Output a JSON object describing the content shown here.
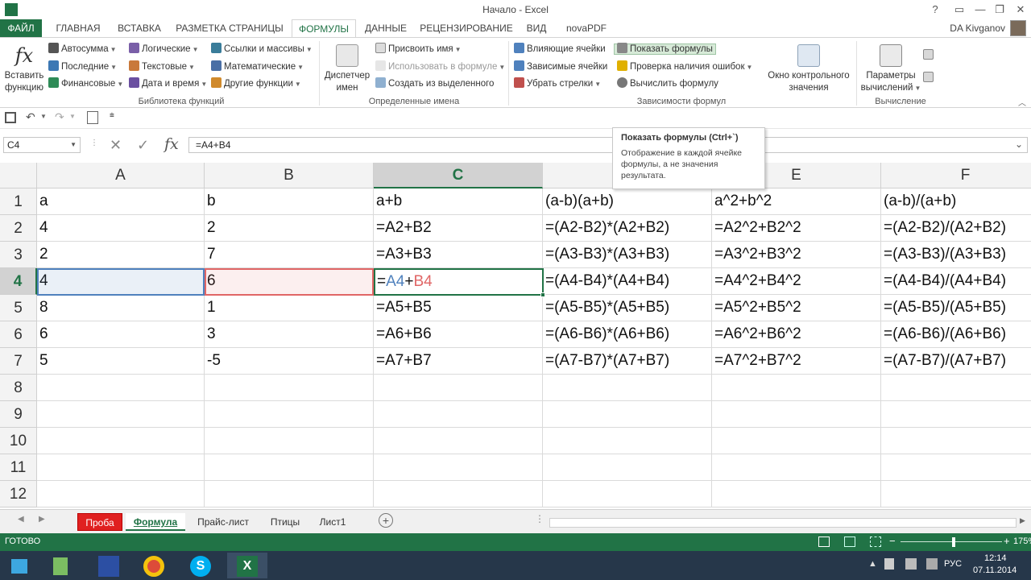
{
  "window": {
    "title": "Начало - Excel",
    "help": "?",
    "minimize": "—",
    "maximize": "❐",
    "close": "✕"
  },
  "tabs": [
    "ФАЙЛ",
    "ГЛАВНАЯ",
    "ВСТАВКА",
    "РАЗМЕТКА СТРАНИЦЫ",
    "ФОРМУЛЫ",
    "ДАННЫЕ",
    "РЕЦЕНЗИРОВАНИЕ",
    "ВИД",
    "novaPDF"
  ],
  "active_tab": "ФОРМУЛЫ",
  "user": "DA Kivganov",
  "ribbon": {
    "insert_fn": {
      "line1": "Вставить",
      "line2": "функцию",
      "icon_glyph": "fx"
    },
    "lib": {
      "autosum": "Автосумма",
      "recent": "Последние",
      "financial": "Финансовые",
      "logical": "Логические",
      "text": "Текстовые",
      "datetime": "Дата и время",
      "lookup": "Ссылки и массивы",
      "math": "Математические",
      "other": "Другие функции",
      "label": "Библиотека функций"
    },
    "names": {
      "manager_l1": "Диспетчер",
      "manager_l2": "имен",
      "assign": "Присвоить имя",
      "use_in_formula": "Использовать в формуле",
      "create_from_sel": "Создать из выделенного",
      "label": "Определенные имена"
    },
    "audit": {
      "precedents": "Влияющие ячейки",
      "dependents": "Зависимые ячейки",
      "remove_arrows": "Убрать стрелки",
      "show_formulas": "Показать формулы",
      "error_check": "Проверка наличия ошибок",
      "evaluate": "Вычислить формулу",
      "watch_l1": "Окно контрольного",
      "watch_l2": "значения",
      "label": "Зависимости формул"
    },
    "calc": {
      "options_l1": "Параметры",
      "options_l2": "вычислений",
      "label": "Вычисление"
    }
  },
  "formula_bar": {
    "name_box": "C4",
    "fx": "fx",
    "cancel": "✕",
    "enter": "✓",
    "content": "=A4+B4"
  },
  "tooltip": {
    "title": "Показать формулы (Ctrl+`)",
    "body": "Отображение в каждой ячейке формулы, а не значения результата."
  },
  "columns": [
    "A",
    "B",
    "C",
    "D",
    "E",
    "F"
  ],
  "row_numbers": [
    "1",
    "2",
    "3",
    "4",
    "5",
    "6",
    "7",
    "8",
    "9",
    "10",
    "11",
    "12"
  ],
  "rows": [
    [
      "a",
      "b",
      "a+b",
      "(a-b)(a+b)",
      "a^2+b^2",
      "(a-b)/(a+b)"
    ],
    [
      "4",
      "2",
      "=A2+B2",
      "=(A2-B2)*(A2+B2)",
      "=A2^2+B2^2",
      "=(A2-B2)/(A2+B2)"
    ],
    [
      "2",
      "7",
      "=A3+B3",
      "=(A3-B3)*(A3+B3)",
      "=A3^2+B3^2",
      "=(A3-B3)/(A3+B3)"
    ],
    [
      "4",
      "6",
      "=A4+B4",
      "=(A4-B4)*(A4+B4)",
      "=A4^2+B4^2",
      "=(A4-B4)/(A4+B4)"
    ],
    [
      "8",
      "1",
      "=A5+B5",
      "=(A5-B5)*(A5+B5)",
      "=A5^2+B5^2",
      "=(A5-B5)/(A5+B5)"
    ],
    [
      "6",
      "3",
      "=A6+B6",
      "=(A6-B6)*(A6+B6)",
      "=A6^2+B6^2",
      "=(A6-B6)/(A6+B6)"
    ],
    [
      "5",
      "-5",
      "=A7+B7",
      "=(A7-B7)*(A7+B7)",
      "=A7^2+B7^2",
      "=(A7-B7)/(A7+B7)"
    ],
    [
      "",
      "",
      "",
      "",
      "",
      ""
    ],
    [
      "",
      "",
      "",
      "",
      "",
      ""
    ],
    [
      "",
      "",
      "",
      "",
      "",
      ""
    ],
    [
      "",
      "",
      "",
      "",
      "",
      ""
    ],
    [
      "",
      "",
      "",
      "",
      "",
      ""
    ]
  ],
  "active_cell": {
    "eq": "=",
    "ref_a": "A4",
    "plus": "+",
    "ref_b": "B4"
  },
  "sheets": [
    "Проба",
    "Формула",
    "Прайс-лист",
    "Птицы",
    "Лист1"
  ],
  "active_sheet": "Формула",
  "status": {
    "ready": "ГОТОВО",
    "zoom": "175%",
    "zoom_minus": "−",
    "zoom_plus": "+"
  },
  "taskbar": {
    "lang": "РУС",
    "time": "12:14",
    "date": "07.11.2014"
  },
  "colors": {
    "excel_green": "#217346",
    "ref_a": "#4f81bd",
    "ref_b": "#e06666",
    "tab_red": "#e02020"
  }
}
